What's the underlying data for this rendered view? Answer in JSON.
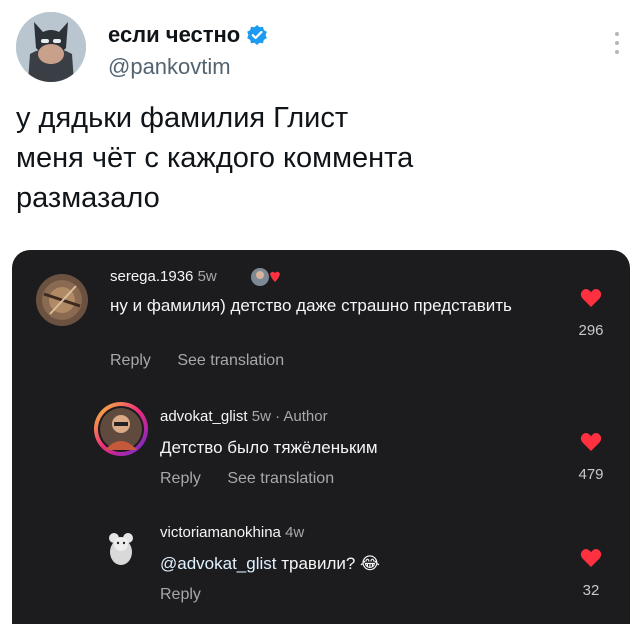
{
  "tweet": {
    "author_name": "если честно",
    "author_handle": "@pankovtim",
    "text": "у дядьки фамилия Глист\nменя чёт с каждого коммента\nразмазало"
  },
  "comments": [
    {
      "username": "serega.1936",
      "time": "5w",
      "text": "ну и фамилия) детство даже страшно представить",
      "reply_label": "Reply",
      "translate_label": "See translation",
      "likes": "296"
    },
    {
      "username": "advokat_glist",
      "time": "5w · Author",
      "text": "Детство было тяжёленьким",
      "reply_label": "Reply",
      "translate_label": "See translation",
      "likes": "479"
    },
    {
      "username": "victoriamanokhina",
      "time": "4w",
      "mention": "@advokat_glist",
      "text": " травили? 😂",
      "reply_label": "Reply",
      "likes": "32"
    }
  ],
  "colors": {
    "card_bg": "#1c1c1f",
    "heart": "#ff3040",
    "verified": "#1d9bf0"
  }
}
